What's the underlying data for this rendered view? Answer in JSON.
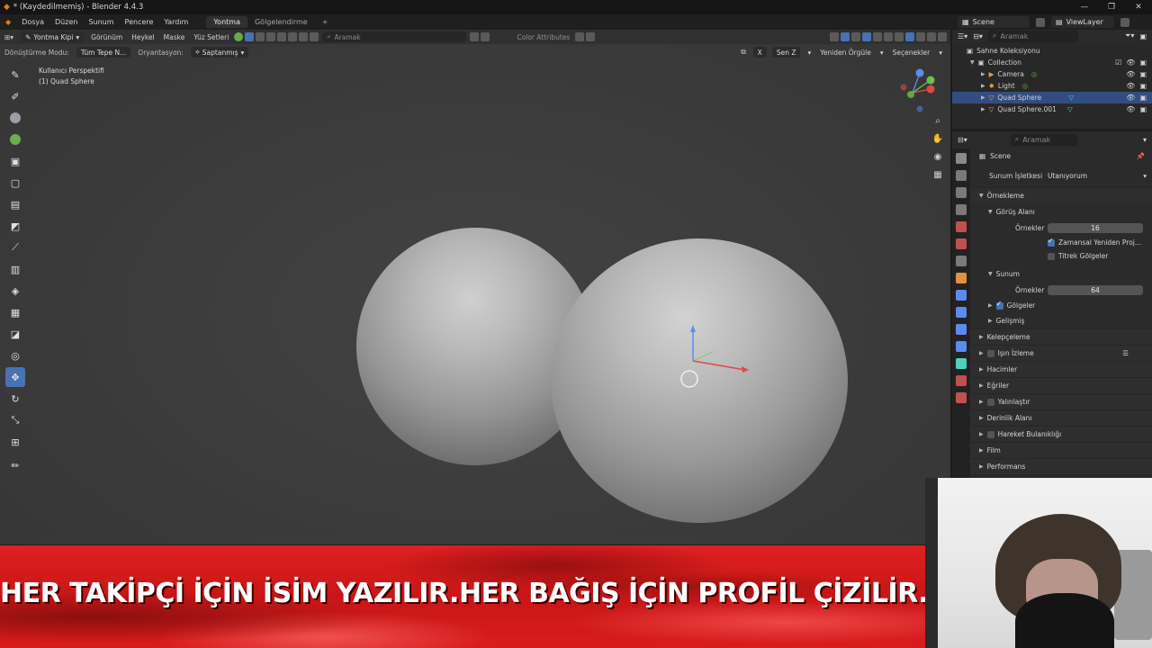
{
  "window": {
    "title": "* (Kaydedilmemiş) - Blender 4.4.3"
  },
  "menu": [
    "Dosya",
    "Düzen",
    "Sunum",
    "Pencere",
    "Yardım"
  ],
  "workspaces": [
    {
      "label": "Yontma",
      "active": true
    },
    {
      "label": "Gölgelendirme",
      "active": false
    }
  ],
  "scene_field": "Scene",
  "viewlayer_field": "ViewLayer",
  "viewport_header": {
    "mode": "Yontma Kipi",
    "menus": [
      "Görünüm",
      "Heykel",
      "Maske",
      "Yüz Setleri"
    ],
    "search_placeholder": "Aramak",
    "color_attributes": "Color Attributes"
  },
  "viewport_header2": {
    "transform_label": "Dönüştürme Modu:",
    "transform_value": "Tüm Tepe N...",
    "orientation_label": "Oryantasyon:",
    "orientation_value": "Saptanmış",
    "symmetry": "X",
    "pivot": "Sen Z",
    "remesh": "Yeniden Örgüle",
    "options": "Seçenekler"
  },
  "viewport_info": {
    "line1": "Kullanıcı Perspektifi",
    "line2": "(1) Quad Sphere"
  },
  "outliner": {
    "search_placeholder": "Aramak",
    "root": "Sahne Koleksiyonu",
    "collection": "Collection",
    "items": [
      {
        "label": "Camera",
        "selected": false,
        "color": "#e8a040"
      },
      {
        "label": "Light",
        "selected": false,
        "color": "#e8a040"
      },
      {
        "label": "Quad Sphere",
        "selected": true,
        "color": "#e8a040"
      },
      {
        "label": "Quad Sphere.001",
        "selected": false,
        "color": "#e8a040"
      }
    ]
  },
  "properties": {
    "search_placeholder": "Aramak",
    "context": "Scene",
    "render_engine_label": "Sunum İşletkesi",
    "render_engine_value": "Utanıyorum",
    "sampling": "Örnekleme",
    "viewport_section": "Görüş Alanı",
    "samples_label": "Örnekler",
    "viewport_samples": "16",
    "temporal_reprojection": "Zamansal Yeniden Proj...",
    "jittered_shadows": "Titrek Gölgeler",
    "render_section": "Sunum",
    "render_samples": "64",
    "shadows": "Gölgeler",
    "advanced": "Gelişmiş",
    "sections": [
      "Kelepçeleme",
      "Işın İzleme",
      "Hacimler",
      "Eğriler",
      "Yalınlaştır",
      "Derinlik Alanı",
      "Hareket Bulanıklığı",
      "Film",
      "Performans"
    ]
  },
  "banner": {
    "text": "HER TAKİPÇİ İÇİN İSİM YAZILIR.HER BAĞIŞ İÇİN PROFİL ÇİZİLİR.  ."
  },
  "colors": {
    "accent": "#4772b3",
    "banner_red": "#d81c1c",
    "selection": "#334d80"
  }
}
